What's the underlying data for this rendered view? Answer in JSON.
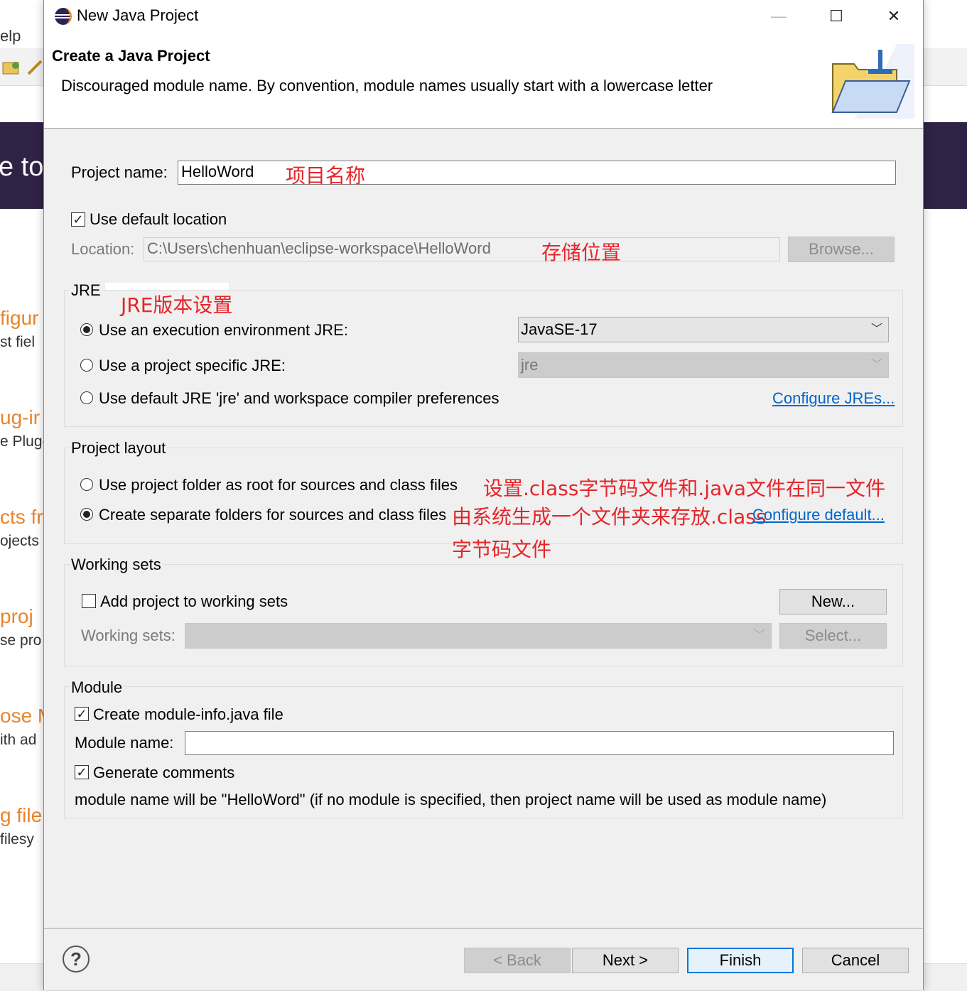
{
  "background": {
    "menu_fragment": "elp",
    "banner_fragment": "e to",
    "entries": [
      {
        "title": "figur",
        "sub": "st fiel"
      },
      {
        "title": "ug-ir",
        "sub": "e Plug-"
      },
      {
        "title": "cts fr",
        "sub": "ojects"
      },
      {
        "title": "proj",
        "sub": "se pro"
      },
      {
        "title": "ose M",
        "sub": "ith ad"
      },
      {
        "title": "g file",
        "sub": "filesy"
      }
    ]
  },
  "window": {
    "title": "New Java Project",
    "minimize": "—",
    "maximize": "☐",
    "close": "✕"
  },
  "header": {
    "title": "Create a Java Project",
    "message": "Discouraged module name. By convention, module names usually start with a lowercase letter"
  },
  "project": {
    "name_label": "Project name:",
    "name_value": "HelloWord",
    "use_default_location_label": "Use default location",
    "use_default_location_checked": true,
    "location_label": "Location:",
    "location_value": "C:\\Users\\chenhuan\\eclipse-workspace\\HelloWord",
    "browse_label": "Browse..."
  },
  "jre": {
    "group_label": "JRE",
    "option_env_label": "Use an execution environment JRE:",
    "option_env_value": "JavaSE-17",
    "option_specific_label": "Use a project specific JRE:",
    "option_specific_value": "jre",
    "option_default_label": "Use default JRE 'jre' and workspace compiler preferences",
    "configure_link": "Configure JREs...",
    "selected": "env"
  },
  "layout": {
    "group_label": "Project layout",
    "option_root_label": "Use project folder as root for sources and class files",
    "option_separate_label": "Create separate folders for sources and class files",
    "configure_link": "Configure default...",
    "selected": "separate"
  },
  "working_sets": {
    "group_label": "Working sets",
    "add_label": "Add project to working sets",
    "add_checked": false,
    "new_label": "New...",
    "sets_label": "Working sets:",
    "select_label": "Select..."
  },
  "module": {
    "group_label": "Module",
    "create_label": "Create module-info.java file",
    "create_checked": true,
    "name_label": "Module name:",
    "name_value": "",
    "comments_label": "Generate comments",
    "comments_checked": true,
    "info_text": "module name will be \"HelloWord\"  (if no module is specified, then project name will be used as module name)"
  },
  "annotations": {
    "project_name": "项目名称",
    "location": "存储位置",
    "jre": "JRE版本设置",
    "layout_line1": "设置.class字节码文件和.java文件在同一文件",
    "layout_line2": "由系统生成一个文件夹来存放.class",
    "layout_line3": "字节码文件"
  },
  "footer": {
    "help": "?",
    "back_label": "< Back",
    "next_label": "Next >",
    "finish_label": "Finish",
    "cancel_label": "Cancel"
  },
  "colors": {
    "annotation": "#e5252a",
    "link": "#0066cc",
    "banner": "#2f2245",
    "entry_title": "#e8842c"
  }
}
